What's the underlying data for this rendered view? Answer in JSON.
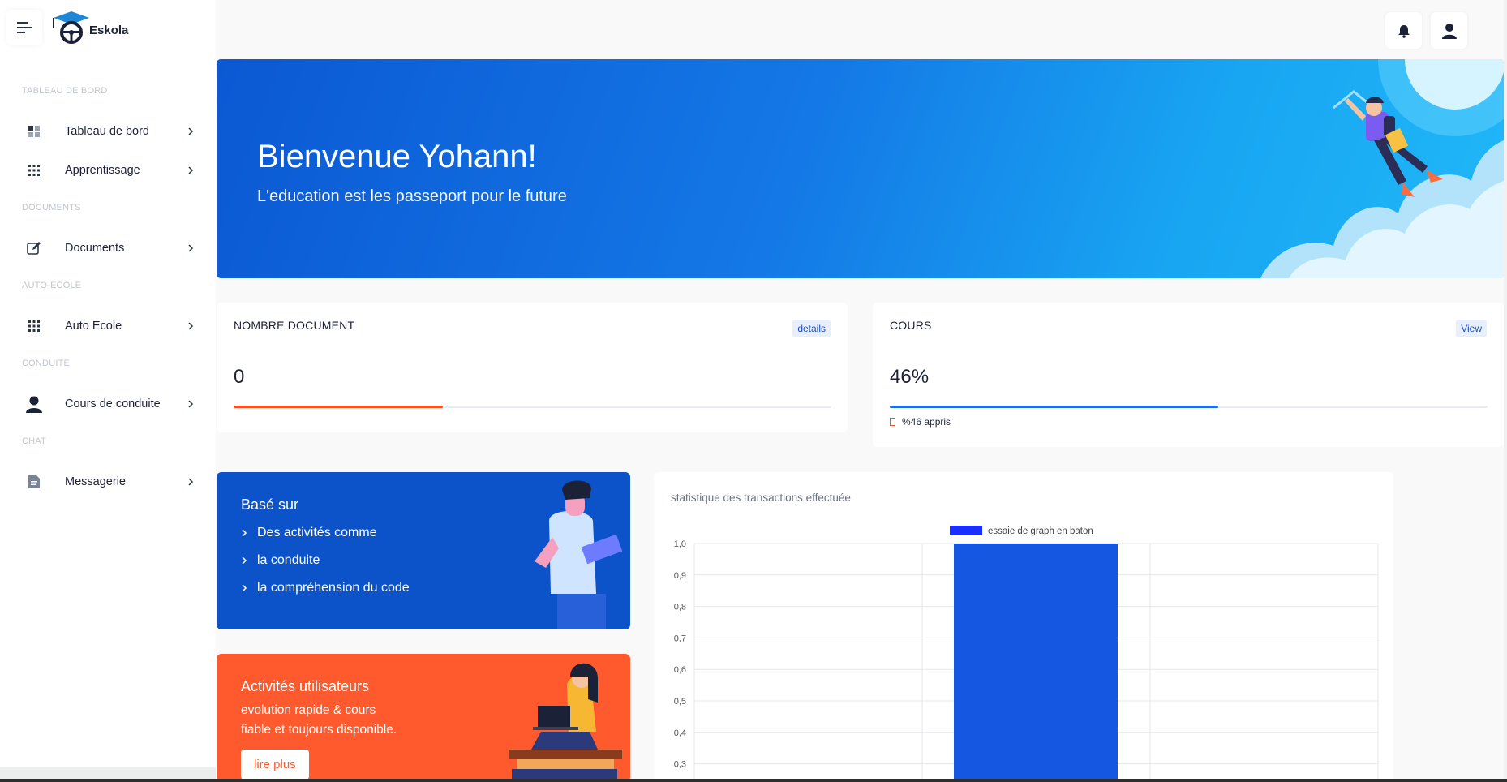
{
  "brand": {
    "name": "Eskola"
  },
  "sidebar": {
    "sections": [
      {
        "title": "TABLEAU DE BORD"
      },
      {
        "title": "DOCUMENTS"
      },
      {
        "title": "AUTO-ECOLE"
      },
      {
        "title": "CONDUITE"
      },
      {
        "title": "CHAT"
      }
    ],
    "items": [
      {
        "label": "Tableau de bord",
        "icon": "dashboard-icon"
      },
      {
        "label": "Apprentissage",
        "icon": "grid-icon"
      },
      {
        "label": "Documents",
        "icon": "edit-icon"
      },
      {
        "label": "Auto Ecole",
        "icon": "grid-icon"
      },
      {
        "label": "Cours de conduite",
        "icon": "user-icon"
      },
      {
        "label": "Messagerie",
        "icon": "document-icon"
      }
    ]
  },
  "topbar": {
    "notification_icon": "bell-icon",
    "profile_icon": "user-icon"
  },
  "hero": {
    "title": "Bienvenue Yohann!",
    "subtitle": "L'education est les passeport pour le future"
  },
  "stats": {
    "documents": {
      "title": "NOMBRE DOCUMENT",
      "tag": "details",
      "value": "0",
      "progress": 0.35,
      "color": "#f4511e"
    },
    "cours": {
      "title": "COURS",
      "tag": "View",
      "value": "46%",
      "progress": 0.55,
      "color": "#1f6fe0",
      "note": "%46 appris"
    }
  },
  "promo_base": {
    "title": "Basé sur",
    "items": [
      "Des activités comme",
      "la conduite",
      "la compréhension du code"
    ],
    "color": "#0c52c9"
  },
  "promo_activity": {
    "title": "Activités utilisateurs",
    "line1": "evolution rapide & cours",
    "line2": "fiable et toujours disponible.",
    "button": "lire plus",
    "color": "#ff5a2e"
  },
  "chart_title": "statistique des transactions effectuée",
  "chart_data": {
    "type": "bar",
    "categories": [
      ""
    ],
    "series": [
      {
        "name": "essaie de graph en baton",
        "values": [
          1.0
        ]
      }
    ],
    "ylim": [
      0.3,
      1.0
    ],
    "yticks": [
      "1,0",
      "0,9",
      "0,8",
      "0,7",
      "0,6",
      "0,5",
      "0,4",
      "0,3"
    ],
    "grid": true,
    "legend": "top-center",
    "bar_color": "#1557e0",
    "legend_color": "#1a2fff"
  }
}
